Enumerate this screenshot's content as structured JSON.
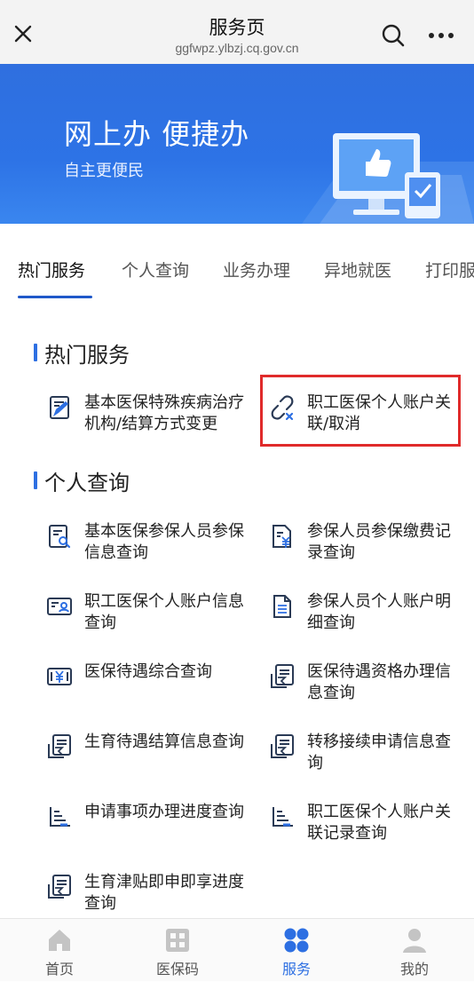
{
  "topbar": {
    "title": "服务页",
    "url": "ggfwpz.ylbzj.cq.gov.cn"
  },
  "banner": {
    "headline": "网上办 便捷办",
    "subline": "自主更便民"
  },
  "tabs": [
    "热门服务",
    "个人查询",
    "业务办理",
    "异地就医",
    "打印服"
  ],
  "sections": {
    "hot": {
      "title": "热门服务",
      "items": [
        {
          "label": "基本医保特殊疾病治疗机构/结算方式变更",
          "icon": "edit-doc-icon"
        },
        {
          "label": "职工医保个人账户关联/取消",
          "icon": "unlink-icon"
        }
      ]
    },
    "personal": {
      "title": "个人查询",
      "items": [
        {
          "label": "基本医保参保人员参保信息查询",
          "icon": "doc-search-icon"
        },
        {
          "label": "参保人员参保缴费记录查询",
          "icon": "doc-yen-icon"
        },
        {
          "label": "职工医保个人账户信息查询",
          "icon": "id-card-icon"
        },
        {
          "label": "参保人员个人账户明细查询",
          "icon": "doc-lines-icon"
        },
        {
          "label": "医保待遇综合查询",
          "icon": "yen-card-icon"
        },
        {
          "label": "医保待遇资格办理信息查询",
          "icon": "doc-stack-icon"
        },
        {
          "label": "生育待遇结算信息查询",
          "icon": "doc-stack-icon"
        },
        {
          "label": "转移接续申请信息查询",
          "icon": "doc-stack-icon"
        },
        {
          "label": "申请事项办理进度查询",
          "icon": "progress-chart-icon"
        },
        {
          "label": "职工医保个人账户关联记录查询",
          "icon": "progress-chart-icon"
        },
        {
          "label": "生育津贴即申即享进度查询",
          "icon": "doc-stack-icon"
        }
      ]
    }
  },
  "bottomnav": [
    {
      "label": "首页",
      "icon": "home-icon"
    },
    {
      "label": "医保码",
      "icon": "qr-code-icon"
    },
    {
      "label": "服务",
      "icon": "service-grid-icon"
    },
    {
      "label": "我的",
      "icon": "user-icon"
    }
  ],
  "colors": {
    "accent": "#2d6fe2",
    "banner": "#2f6fdf",
    "highlight": "#e02a2a",
    "navy_icon": "#2a3a55"
  }
}
